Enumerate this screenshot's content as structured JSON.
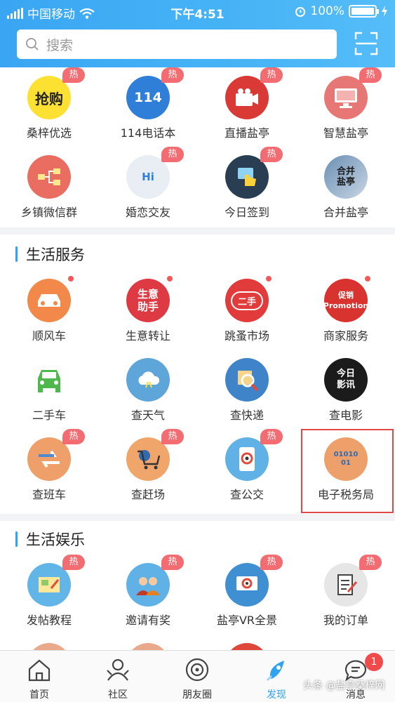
{
  "status_bar": {
    "carrier": "中国移动",
    "time": "下午4:51",
    "battery": "100%"
  },
  "search": {
    "placeholder": "搜索"
  },
  "top_grid": [
    {
      "label": "桑梓优选",
      "hot": "热",
      "icon_text": "抢购"
    },
    {
      "label": "114电话本",
      "hot": "热",
      "icon_text": "114"
    },
    {
      "label": "直播盐亭",
      "hot": "热"
    },
    {
      "label": "智慧盐亭",
      "hot": "热"
    },
    {
      "label": "乡镇微信群"
    },
    {
      "label": "婚恋交友",
      "hot": "热",
      "icon_text": "Hi"
    },
    {
      "label": "今日签到",
      "hot": "热"
    },
    {
      "label": "合并盐亭",
      "icon_text": "合并 盐亭"
    }
  ],
  "life_services": {
    "title": "生活服务",
    "items": [
      {
        "label": "顺风车",
        "dot": true
      },
      {
        "label": "生意转让",
        "dot": true,
        "icon_text": "生意 助手"
      },
      {
        "label": "跳蚤市场",
        "dot": true,
        "icon_text": "二手"
      },
      {
        "label": "商家服务",
        "dot": true,
        "icon_text": "促销 Promotion"
      },
      {
        "label": "二手车"
      },
      {
        "label": "查天气"
      },
      {
        "label": "查快递"
      },
      {
        "label": "查电影",
        "icon_text": "今日 影讯"
      },
      {
        "label": "查班车",
        "hot": "热"
      },
      {
        "label": "查赶场",
        "hot": "热"
      },
      {
        "label": "查公交",
        "hot": "热"
      },
      {
        "label": "电子税务局",
        "icon_text": "01010 01"
      }
    ]
  },
  "life_entertainment": {
    "title": "生活娱乐",
    "items": [
      {
        "label": "发帖教程",
        "hot": "热"
      },
      {
        "label": "邀请有奖",
        "hot": "热"
      },
      {
        "label": "盐亭VR全景",
        "hot": "热"
      },
      {
        "label": "我的订单",
        "hot": "热"
      }
    ]
  },
  "tabbar": {
    "items": [
      {
        "label": "首页"
      },
      {
        "label": "社区"
      },
      {
        "label": "朋友圈"
      },
      {
        "label": "发现"
      },
      {
        "label": "消息"
      }
    ],
    "message_badge": "1"
  },
  "watermark": "头条 @盐亭桑梓网",
  "colors": {
    "header": "#3aa6f3",
    "hot_tag": "#f36c71",
    "accent": "#2fa3ef",
    "highlight_box": "#e04848"
  }
}
